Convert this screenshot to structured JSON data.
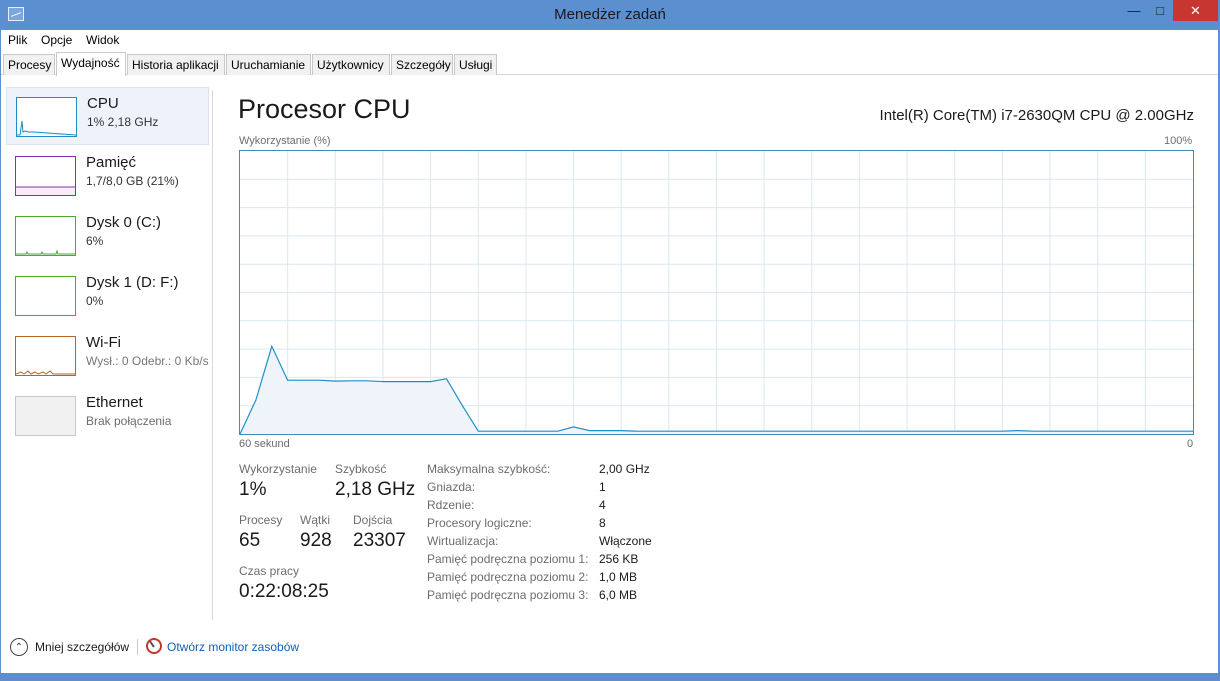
{
  "window": {
    "title": "Menedżer zadań"
  },
  "menu": [
    "Plik",
    "Opcje",
    "Widok"
  ],
  "tabs": [
    "Procesy",
    "Wydajność",
    "Historia aplikacji",
    "Uruchamianie",
    "Użytkownicy",
    "Szczegóły",
    "Usługi"
  ],
  "active_tab": "Wydajność",
  "sidebar": [
    {
      "title": "CPU",
      "sub": "1% 2,18 GHz",
      "color": "#1e8fc6",
      "selected": true
    },
    {
      "title": "Pamięć",
      "sub": "1,7/8,0 GB (21%)",
      "color": "#8b2fad",
      "selected": false
    },
    {
      "title": "Dysk 0 (C:)",
      "sub": "6%",
      "color": "#4da82c",
      "selected": false
    },
    {
      "title": "Dysk 1 (D: F:)",
      "sub": "0%",
      "color": "#4da82c",
      "selected": false
    },
    {
      "title": "Wi-Fi",
      "sub_prefix": "Wysł.: 0",
      "sub": "Odebr.: 0 Kb/s",
      "color": "#b9651f",
      "selected": false
    },
    {
      "title": "Ethernet",
      "sub": "Brak połączenia",
      "color": "#c9c9c9",
      "selected": false
    }
  ],
  "cpu": {
    "heading": "Procesor CPU",
    "model": "Intel(R) Core(TM) i7-2630QM CPU @ 2.00GHz",
    "graph": {
      "ylabel": "Wykorzystanie (%)",
      "ymax_label": "100%",
      "xlabel_left": "60 sekund",
      "xlabel_right": "0",
      "color": "#1e8fc6",
      "fill": "#eef4fa",
      "grid_color": "#d8e8f3",
      "usage_percent": [
        0,
        12,
        31,
        19,
        19,
        19,
        18.7,
        18.8,
        18.8,
        18.5,
        18.5,
        18.5,
        18.5,
        19.5,
        10,
        1,
        1,
        1,
        1,
        1,
        1,
        2.5,
        1.2,
        1.2,
        1.2,
        1,
        1,
        1,
        1,
        1,
        1,
        1,
        1,
        1,
        1,
        1,
        1,
        1,
        1,
        1,
        1,
        1,
        1,
        1,
        1,
        1,
        1,
        1,
        1,
        1.2,
        1,
        1,
        1,
        1,
        1,
        1,
        1,
        1,
        1,
        1,
        1
      ]
    },
    "stats": {
      "usage_label": "Wykorzystanie",
      "usage": "1%",
      "speed_label": "Szybkość",
      "speed": "2,18 GHz",
      "processes_label": "Procesy",
      "processes": "65",
      "threads_label": "Wątki",
      "threads": "928",
      "handles_label": "Dojścia",
      "handles": "23307",
      "uptime_label": "Czas pracy",
      "uptime": "0:22:08:25"
    },
    "specs": [
      {
        "label": "Maksymalna szybkość:",
        "value": "2,00 GHz"
      },
      {
        "label": "Gniazda:",
        "value": "1"
      },
      {
        "label": "Rdzenie:",
        "value": "4"
      },
      {
        "label": "Procesory logiczne:",
        "value": "8"
      },
      {
        "label": "Wirtualizacja:",
        "value": "Włączone"
      },
      {
        "label": "Pamięć podręczna poziomu 1:",
        "value": "256 KB"
      },
      {
        "label": "Pamięć podręczna poziomu 2:",
        "value": "1,0 MB"
      },
      {
        "label": "Pamięć podręczna poziomu 3:",
        "value": "6,0 MB"
      }
    ]
  },
  "footer": {
    "less_details": "Mniej szczegółów",
    "open_monitor": "Otwórz monitor zasobów"
  },
  "icons": {
    "minimize": "minimize-icon",
    "maximize": "maximize-icon",
    "close": "close-icon",
    "collapse": "chevron-up-icon",
    "monitor": "resource-monitor-icon"
  }
}
